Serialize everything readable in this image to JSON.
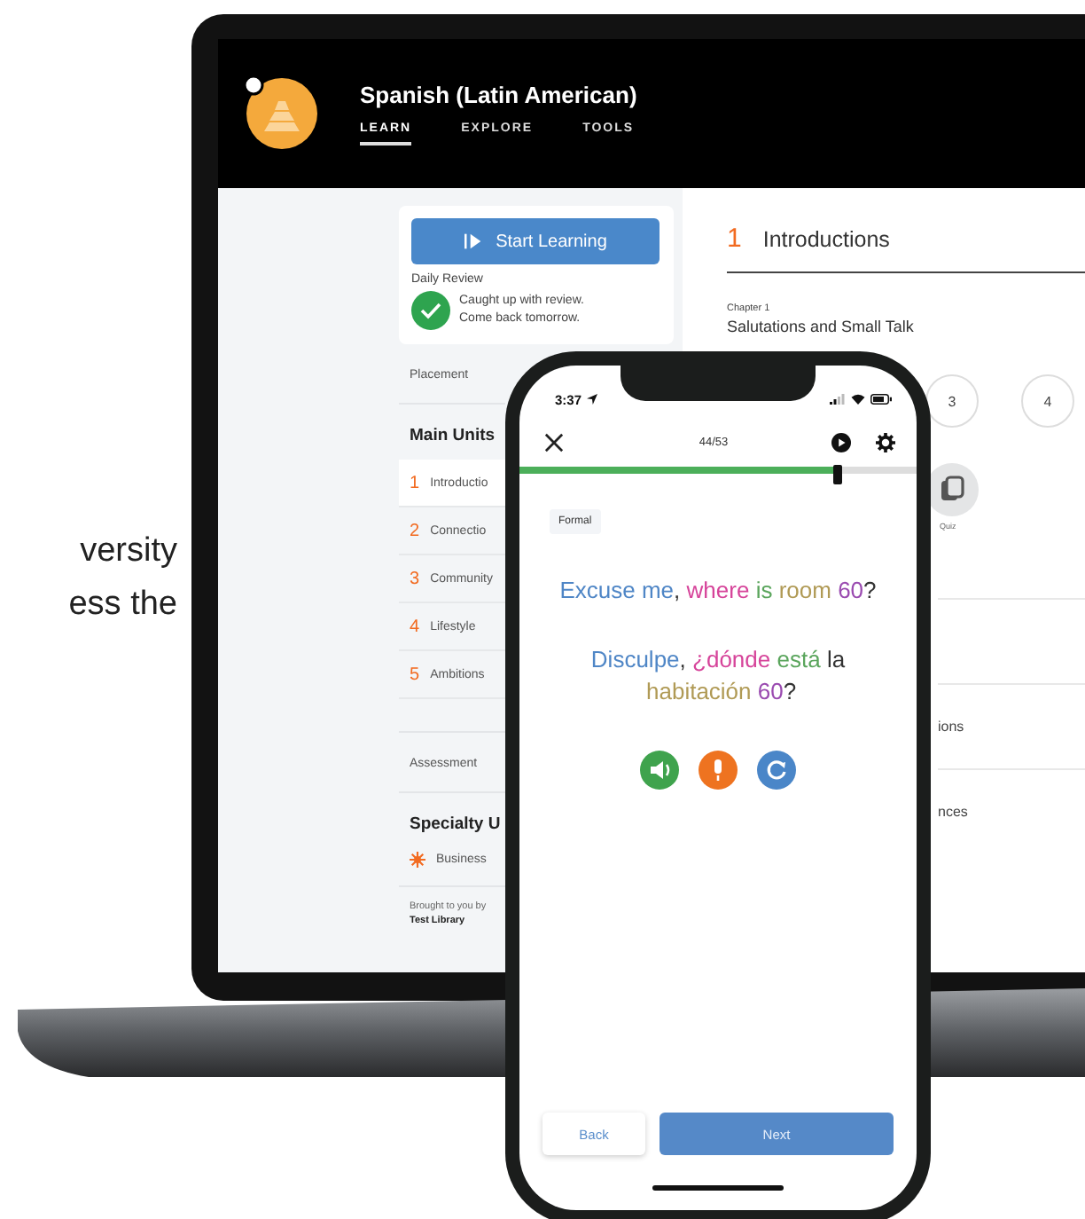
{
  "page_text": [
    "versity",
    "ess the"
  ],
  "laptop": {
    "course_title": "Spanish (Latin American)",
    "nav": [
      {
        "label": "LEARN",
        "selected": true
      },
      {
        "label": "EXPLORE",
        "selected": false
      },
      {
        "label": "TOOLS",
        "selected": false
      }
    ],
    "start_button": "Start Learning",
    "daily_review": {
      "heading": "Daily Review",
      "message": [
        "Caught up with review.",
        "Come back tomorrow."
      ]
    },
    "sidebar": {
      "placement": "Placement",
      "main_heading": "Main Units",
      "units": [
        {
          "number": "1",
          "label": "Introductio",
          "selected": true
        },
        {
          "number": "2",
          "label": "Connectio",
          "selected": false
        },
        {
          "number": "3",
          "label": "Community",
          "selected": false
        },
        {
          "number": "4",
          "label": "Lifestyle",
          "selected": false
        },
        {
          "number": "5",
          "label": "Ambitions",
          "selected": false
        }
      ],
      "assessment": "Assessment",
      "specialty_heading": "Specialty U",
      "specialty": [
        "Business"
      ],
      "credit": "Brought to you by",
      "library": "Test Library"
    },
    "main": {
      "unit_number": "1",
      "unit_title": "Introductions",
      "chapter_label": "Chapter 1",
      "chapter_title": "Salutations and Small Talk",
      "steps": [
        "3",
        "4"
      ],
      "quiz_label": "Quiz",
      "rows": [
        "ions",
        "nces"
      ]
    }
  },
  "phone": {
    "time": "3:37",
    "progress_text": "44/53",
    "progress": {
      "level": 0.8
    },
    "tag": "Formal",
    "prompt": [
      {
        "text": "Excuse me",
        "color": "#4f86c6",
        "punctuation": ","
      },
      {
        "text": "where",
        "color": "#d6449a"
      },
      {
        "text": "is",
        "color": "#5aa55c"
      },
      {
        "text": "room",
        "color": "#b09a55"
      },
      {
        "text": "60",
        "color": "#9a4bb0",
        "punctuation": "?"
      }
    ],
    "answer": [
      {
        "text": "Disculpe",
        "color": "#4f86c6",
        "punctuation": ","
      },
      {
        "text": "¿dónde",
        "color": "#d6449a"
      },
      {
        "text": "está",
        "color": "#5aa55c"
      },
      {
        "text": "la",
        "color": "#333333"
      },
      {
        "text": "habitación",
        "color": "#b09a55"
      },
      {
        "text": "60",
        "color": "#9a4bb0",
        "punctuation": "?"
      }
    ],
    "back_button": "Back",
    "next_button": "Next"
  }
}
